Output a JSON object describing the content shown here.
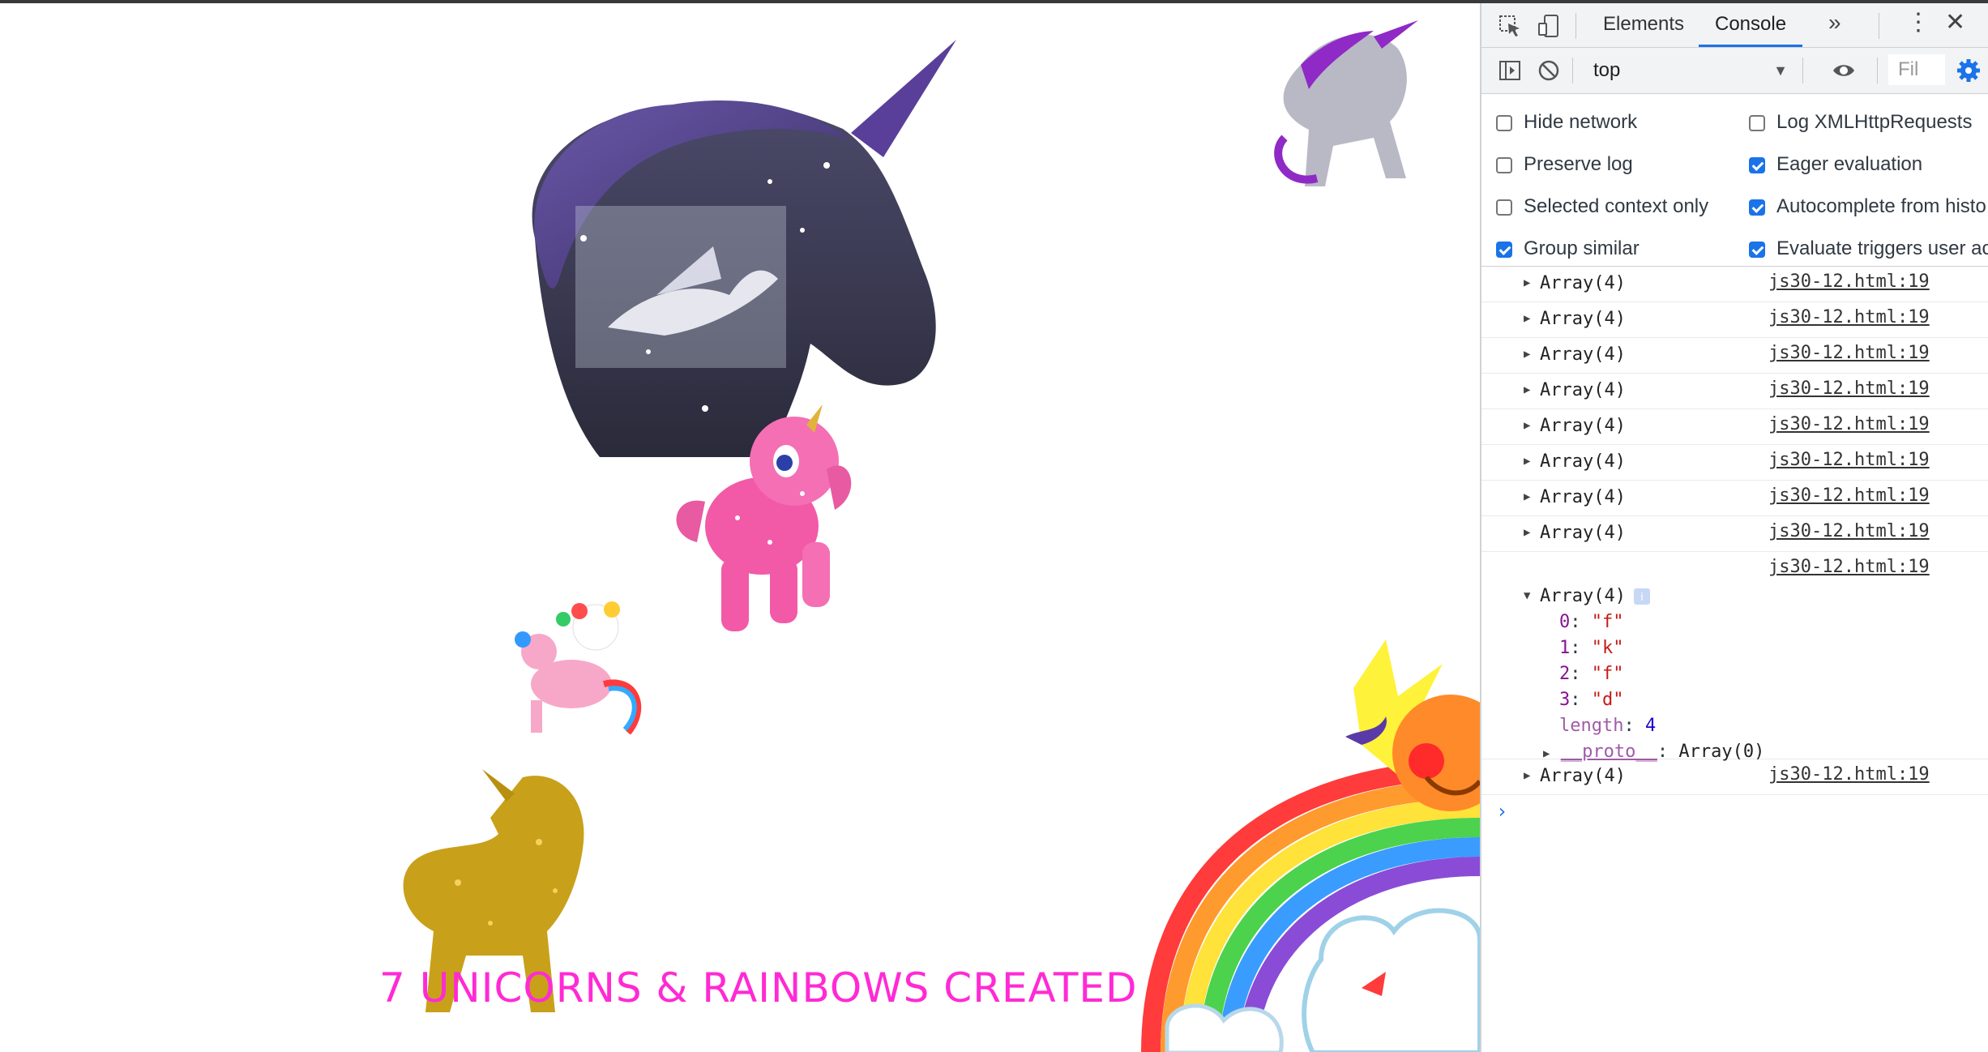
{
  "page": {
    "caption": "7 UNICORNS & RAINBOWS CREATED"
  },
  "devtools": {
    "tabs": [
      "Elements",
      "Console"
    ],
    "active_tab": "Console",
    "more_tabs_icon": "chevron-double-right-icon",
    "context": "top",
    "filter_placeholder": "Fil",
    "settings": [
      {
        "label": "Hide network",
        "checked": false
      },
      {
        "label": "Log XMLHttpRequests",
        "checked": false
      },
      {
        "label": "Preserve log",
        "checked": false
      },
      {
        "label": "Eager evaluation",
        "checked": true
      },
      {
        "label": "Selected context only",
        "checked": false
      },
      {
        "label": "Autocomplete from histo",
        "checked": true
      },
      {
        "label": "Group similar",
        "checked": true
      },
      {
        "label": "Evaluate triggers user ac",
        "checked": true
      }
    ],
    "log_source": "js30-12.html:19",
    "log_text": "Array(4)",
    "expanded": {
      "items": [
        {
          "key": "0",
          "value": "\"f\""
        },
        {
          "key": "1",
          "value": "\"k\""
        },
        {
          "key": "2",
          "value": "\"f\""
        },
        {
          "key": "3",
          "value": "\"d\""
        }
      ],
      "length_key": "length",
      "length_value": "4",
      "proto_key": "__proto__",
      "proto_value": "Array(0)",
      "info_badge": "i"
    },
    "prompt_symbol": "›"
  },
  "colors": {
    "accent": "#1a73e8",
    "caption": "#ff2ad4"
  }
}
